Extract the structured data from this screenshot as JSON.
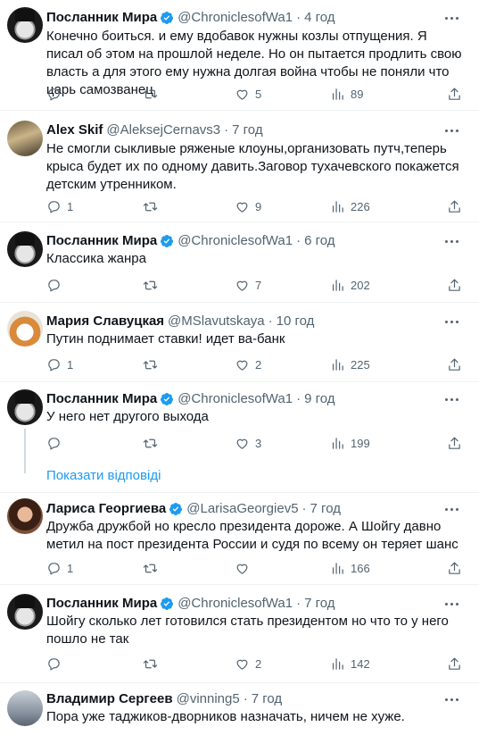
{
  "tweets": [
    {
      "name": "Посланник Мира",
      "handle": "@ChroniclesofWa1",
      "time": "4 год",
      "verified": true,
      "avatar": "top-hat-man-avatar",
      "text": "Конечно боиться. и ему вдобавок нужны козлы отпущения. Я писал об этом на прошлой неделе. Но он пытается продлить свою власть а для этого ему нужна долгая война чтобы не поняли что царь самозванец",
      "replies": "",
      "retweets": "",
      "likes": "5",
      "views": "89"
    },
    {
      "name": "Alex Skif",
      "handle": "@AleksejCernavs3",
      "time": "7 год",
      "verified": false,
      "avatar": "soldier-avatar",
      "text": "Не смогли сыкливые ряженые клоуны,организовать путч,теперь крыса будет их по одному давить.Заговор тухачевского покажется детским утренником.",
      "replies": "1",
      "retweets": "",
      "likes": "9",
      "views": "226"
    },
    {
      "name": "Посланник Мира",
      "handle": "@ChroniclesofWa1",
      "time": "6 год",
      "verified": true,
      "avatar": "top-hat-man-avatar",
      "text": "Классика жанра",
      "replies": "",
      "retweets": "",
      "likes": "7",
      "views": "202"
    },
    {
      "name": "Мария Славуцкая",
      "handle": "@MSlavutskaya",
      "time": "10 год",
      "verified": false,
      "avatar": "fox-avatar",
      "text": "Путин поднимает ставки! идет ва-банк",
      "replies": "1",
      "retweets": "",
      "likes": "2",
      "views": "225"
    },
    {
      "name": "Посланник Мира",
      "handle": "@ChroniclesofWa1",
      "time": "9 год",
      "verified": true,
      "avatar": "top-hat-man-avatar",
      "text": "У него нет другого выхода",
      "replies": "",
      "retweets": "",
      "likes": "3",
      "views": "199"
    },
    {
      "name": "Лариса Георгиева",
      "handle": "@LarisaGeorgiev5",
      "time": "7 год",
      "verified": true,
      "avatar": "woman-avatar",
      "text": "Дружба дружбой но кресло президента дороже. А Шойгу давно метил на пост президента России и судя по всему он теряет шанс",
      "replies": "1",
      "retweets": "",
      "likes": "",
      "views": "166"
    },
    {
      "name": "Посланник Мира",
      "handle": "@ChroniclesofWa1",
      "time": "7 год",
      "verified": true,
      "avatar": "top-hat-man-avatar",
      "text": "Шойгу сколько лет готовился стать президентом но что то у него пошло не так",
      "replies": "",
      "retweets": "",
      "likes": "2",
      "views": "142"
    },
    {
      "name": "Владимир Сергеев",
      "handle": "@vinning5",
      "time": "7 год",
      "verified": false,
      "avatar": "landscape-avatar",
      "text": "Пора уже таджиков-дворников назначать, ничем не хуже.",
      "replies": "",
      "retweets": "",
      "likes": "",
      "views": ""
    }
  ],
  "show_replies": "Показати відповіді",
  "colors": {
    "accent": "#1d9bf0",
    "muted": "#536471",
    "text": "#0f1419"
  }
}
